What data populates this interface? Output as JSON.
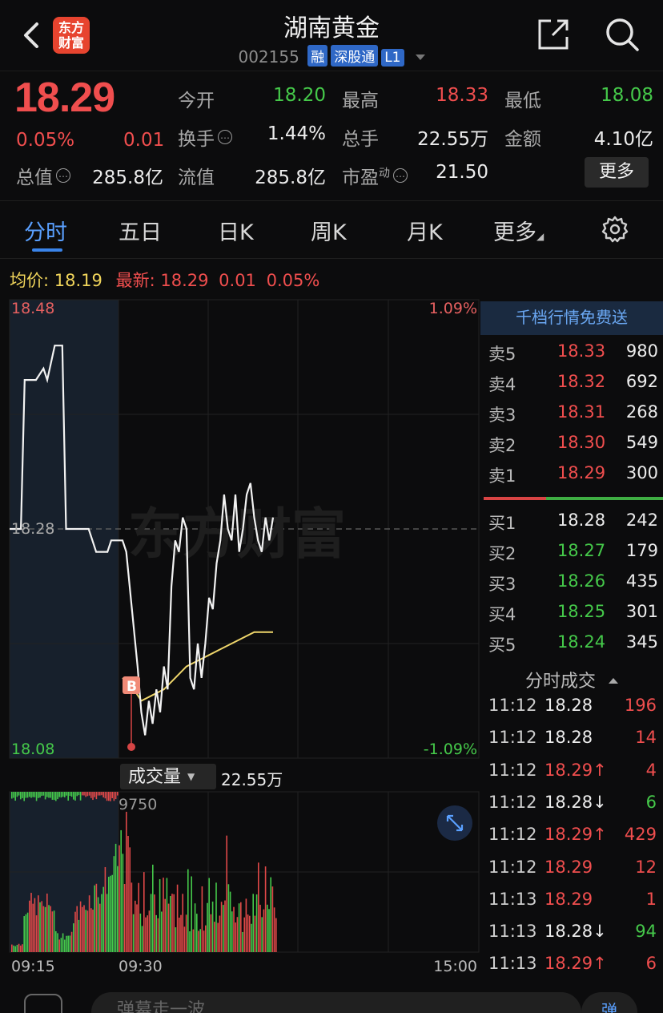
{
  "header": {
    "logo_line1": "东方",
    "logo_line2": "财富",
    "title": "湖南黄金",
    "code": "002155",
    "tag_margin": "融",
    "tag_connect": "深股通",
    "tag_level": "L1"
  },
  "quote": {
    "price": "18.29",
    "change_pct": "0.05%",
    "change": "0.01",
    "open_label": "今开",
    "open": "18.20",
    "high_label": "最高",
    "high": "18.33",
    "low_label": "最低",
    "low": "18.08",
    "turnover_label": "换手",
    "turnover": "1.44%",
    "volume_label": "总手",
    "volume": "22.55万",
    "amount_label": "金额",
    "amount": "4.10亿",
    "mktcap_label": "总值",
    "mktcap": "285.8亿",
    "float_label": "流值",
    "float_cap": "285.8亿",
    "pe_label": "市盈",
    "pe_sup": "动",
    "pe": "21.50",
    "more_label": "更多"
  },
  "tabs": [
    "分时",
    "五日",
    "日K",
    "周K",
    "月K",
    "更多"
  ],
  "avg_line": {
    "avg_label": "均价:",
    "avg_value": "18.19",
    "latest_label": "最新:",
    "latest_price": "18.29",
    "latest_change": "0.01",
    "latest_pct": "0.05%"
  },
  "chart_data": {
    "type": "line",
    "title": "",
    "y_labels": {
      "top": "18.48",
      "mid": "18.28",
      "bottom": "18.08"
    },
    "pct_labels": {
      "top": "1.09%",
      "bottom": "-1.09%"
    },
    "ylim": [
      18.08,
      18.48
    ],
    "x_ticks": [
      "09:15",
      "09:30",
      "15:00"
    ],
    "watermark": "东方财富",
    "buy_marker": "B",
    "series": [
      {
        "style": "price",
        "points": [
          [
            0,
            18.28
          ],
          [
            3,
            18.28
          ],
          [
            4,
            18.41
          ],
          [
            7,
            18.41
          ],
          [
            9,
            18.42
          ],
          [
            10,
            18.41
          ],
          [
            12,
            18.44
          ],
          [
            14,
            18.44
          ],
          [
            15,
            18.28
          ],
          [
            21,
            18.28
          ],
          [
            22,
            18.27
          ],
          [
            23,
            18.26
          ],
          [
            26,
            18.26
          ],
          [
            27,
            18.27
          ],
          [
            30,
            18.27
          ],
          [
            31,
            18.26
          ],
          [
            34,
            18.16
          ],
          [
            35,
            18.12
          ],
          [
            36,
            18.1
          ],
          [
            37,
            18.13
          ],
          [
            38,
            18.11
          ],
          [
            39,
            18.14
          ],
          [
            40,
            18.12
          ],
          [
            41,
            18.16
          ],
          [
            42,
            18.14
          ],
          [
            43,
            18.23
          ],
          [
            44,
            18.27
          ],
          [
            45,
            18.26
          ],
          [
            46,
            18.29
          ],
          [
            47,
            18.28
          ],
          [
            48,
            18.15
          ],
          [
            49,
            18.14
          ],
          [
            50,
            18.18
          ],
          [
            51,
            18.15
          ],
          [
            52,
            18.18
          ],
          [
            53,
            18.22
          ],
          [
            54,
            18.21
          ],
          [
            55,
            18.25
          ],
          [
            56,
            18.27
          ],
          [
            57,
            18.31
          ],
          [
            58,
            18.28
          ],
          [
            59,
            18.27
          ],
          [
            60,
            18.31
          ],
          [
            61,
            18.26
          ],
          [
            62,
            18.28
          ],
          [
            63,
            18.31
          ],
          [
            64,
            18.32
          ],
          [
            65,
            18.29
          ],
          [
            66,
            18.27
          ],
          [
            67,
            18.26
          ],
          [
            68,
            18.29
          ],
          [
            69,
            18.27
          ],
          [
            70,
            18.29
          ]
        ]
      },
      {
        "style": "average",
        "points": [
          [
            30,
            18.15
          ],
          [
            33,
            18.14
          ],
          [
            35,
            18.13
          ],
          [
            38,
            18.135
          ],
          [
            41,
            18.14
          ],
          [
            44,
            18.15
          ],
          [
            47,
            18.16
          ],
          [
            50,
            18.165
          ],
          [
            53,
            18.17
          ],
          [
            56,
            18.175
          ],
          [
            59,
            18.18
          ],
          [
            62,
            18.185
          ],
          [
            65,
            18.19
          ],
          [
            68,
            18.19
          ],
          [
            70,
            18.19
          ]
        ]
      }
    ],
    "volume_axis_label": "9750",
    "volume_total_label": "成交量",
    "volume_total": "22.55万"
  },
  "order_book": {
    "banner": "千档行情免费送",
    "asks": [
      {
        "label": "卖5",
        "price": "18.33",
        "volume": "980",
        "color": "red"
      },
      {
        "label": "卖4",
        "price": "18.32",
        "volume": "692",
        "color": "red"
      },
      {
        "label": "卖3",
        "price": "18.31",
        "volume": "268",
        "color": "red"
      },
      {
        "label": "卖2",
        "price": "18.30",
        "volume": "549",
        "color": "red"
      },
      {
        "label": "卖1",
        "price": "18.29",
        "volume": "300",
        "color": "red"
      }
    ],
    "bids": [
      {
        "label": "买1",
        "price": "18.28",
        "volume": "242",
        "color": "white"
      },
      {
        "label": "买2",
        "price": "18.27",
        "volume": "179",
        "color": "green"
      },
      {
        "label": "买3",
        "price": "18.26",
        "volume": "435",
        "color": "green"
      },
      {
        "label": "买4",
        "price": "18.25",
        "volume": "301",
        "color": "green"
      },
      {
        "label": "买5",
        "price": "18.24",
        "volume": "345",
        "color": "green"
      }
    ]
  },
  "trades": {
    "title": "分时成交",
    "rows": [
      {
        "time": "11:12",
        "price": "18.28",
        "vol": "196",
        "pc": "white",
        "vc": "red"
      },
      {
        "time": "11:12",
        "price": "18.28",
        "vol": "14",
        "pc": "white",
        "vc": "red"
      },
      {
        "time": "11:12",
        "price": "18.29↑",
        "vol": "4",
        "pc": "red",
        "vc": "red"
      },
      {
        "time": "11:12",
        "price": "18.28↓",
        "vol": "6",
        "pc": "white",
        "vc": "green"
      },
      {
        "time": "11:12",
        "price": "18.29↑",
        "vol": "429",
        "pc": "red",
        "vc": "red"
      },
      {
        "time": "11:12",
        "price": "18.29",
        "vol": "12",
        "pc": "red",
        "vc": "red"
      },
      {
        "time": "11:13",
        "price": "18.29",
        "vol": "1",
        "pc": "red",
        "vc": "red"
      },
      {
        "time": "11:13",
        "price": "18.28↓",
        "vol": "94",
        "pc": "white",
        "vc": "green"
      },
      {
        "time": "11:13",
        "price": "18.29↑",
        "vol": "6",
        "pc": "red",
        "vc": "red"
      }
    ]
  },
  "bottom": {
    "input_placeholder": "弹幕走一波",
    "send_label": "弹"
  }
}
